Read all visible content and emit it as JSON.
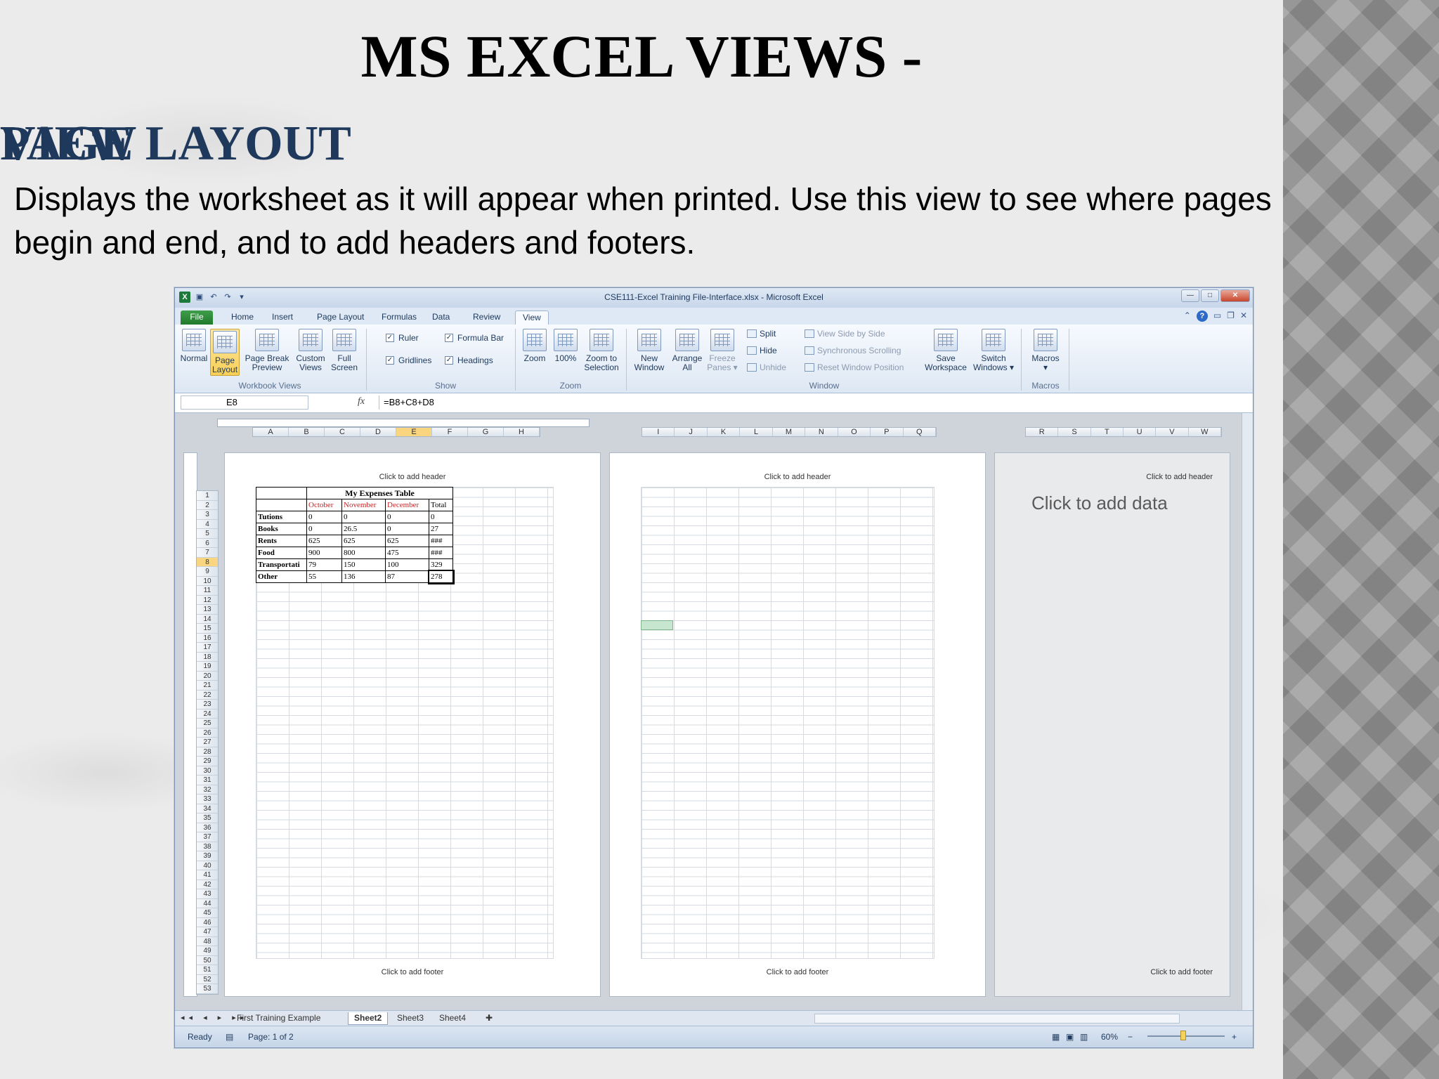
{
  "slide": {
    "title_part1": "MS EXCEL VIEWS - ",
    "title_part2": "PAGE LAYOUT",
    "title_part3": "VIEW",
    "description": "Displays the worksheet as it will appear when printed. Use this view to see where pages begin and end, and to add headers and footers."
  },
  "excel": {
    "window_title": "CSE111-Excel Training File-Interface.xlsx - Microsoft Excel",
    "tabs": [
      "File",
      "Home",
      "Insert",
      "Page Layout",
      "Formulas",
      "Data",
      "Review",
      "View"
    ],
    "active_tab": "View",
    "workbook_views": {
      "normal": "Normal",
      "page_layout_1": "Page",
      "page_layout_2": "Layout",
      "page_break_1": "Page Break",
      "page_break_2": "Preview",
      "custom_1": "Custom",
      "custom_2": "Views",
      "full_1": "Full",
      "full_2": "Screen",
      "group": "Workbook Views"
    },
    "show": {
      "ruler": "Ruler",
      "formula_bar": "Formula Bar",
      "gridlines": "Gridlines",
      "headings": "Headings",
      "check": "✓",
      "group": "Show"
    },
    "zoom": {
      "zoom": "Zoom",
      "hundred": "100%",
      "zoom_sel_1": "Zoom to",
      "zoom_sel_2": "Selection",
      "group": "Zoom"
    },
    "window": {
      "new_1": "New",
      "new_2": "Window",
      "arrange_1": "Arrange",
      "arrange_2": "All",
      "freeze_1": "Freeze",
      "freeze_2": "Panes ▾",
      "split": "Split",
      "hide": "Hide",
      "unhide": "Unhide",
      "side_by_side": "View Side by Side",
      "sync_scroll": "Synchronous Scrolling",
      "reset_pos": "Reset Window Position",
      "save_1": "Save",
      "save_2": "Workspace",
      "switch_1": "Switch",
      "switch_2": "Windows ▾",
      "group": "Window"
    },
    "macros": {
      "label": "Macros",
      "arrow": "▾",
      "group": "Macros"
    },
    "name_box": "E8",
    "fx": "fx",
    "formula": "=B8+C8+D8",
    "columns_page1": [
      "A",
      "B",
      "C",
      "D",
      "E",
      "F",
      "G",
      "H"
    ],
    "columns_page2": [
      "I",
      "J",
      "K",
      "L",
      "M",
      "N",
      "O",
      "P",
      "Q"
    ],
    "columns_page3": [
      "R",
      "S",
      "T",
      "U",
      "V",
      "W"
    ],
    "selected_column": "E",
    "header_placeholder": "Click to add header",
    "footer_placeholder": "Click to add footer",
    "add_data": "Click to add data",
    "table": {
      "title": "My Expenses Table",
      "headers": [
        "October",
        "November",
        "December",
        "Total"
      ],
      "rows": [
        {
          "label": "Tutions",
          "values": [
            "0",
            "0",
            "0",
            "0"
          ]
        },
        {
          "label": "Books",
          "values": [
            "0",
            "26.5",
            "0",
            "27"
          ]
        },
        {
          "label": "Rents",
          "values": [
            "625",
            "625",
            "625",
            "###"
          ]
        },
        {
          "label": "Food",
          "values": [
            "900",
            "800",
            "475",
            "###"
          ]
        },
        {
          "label": "Transportati",
          "values": [
            "79",
            "150",
            "100",
            "329"
          ]
        },
        {
          "label": "Other",
          "values": [
            "55",
            "136",
            "87",
            "278"
          ]
        }
      ]
    },
    "sheet_nav": "◂◂ ◂ ▸ ▸▸",
    "sheets": [
      "First Training Example",
      "Sheet2",
      "Sheet3",
      "Sheet4"
    ],
    "active_sheet": "Sheet2",
    "status": {
      "ready": "Ready",
      "page": "Page: 1 of 2",
      "zoom": "60%",
      "minus": "−",
      "plus": "+"
    }
  }
}
